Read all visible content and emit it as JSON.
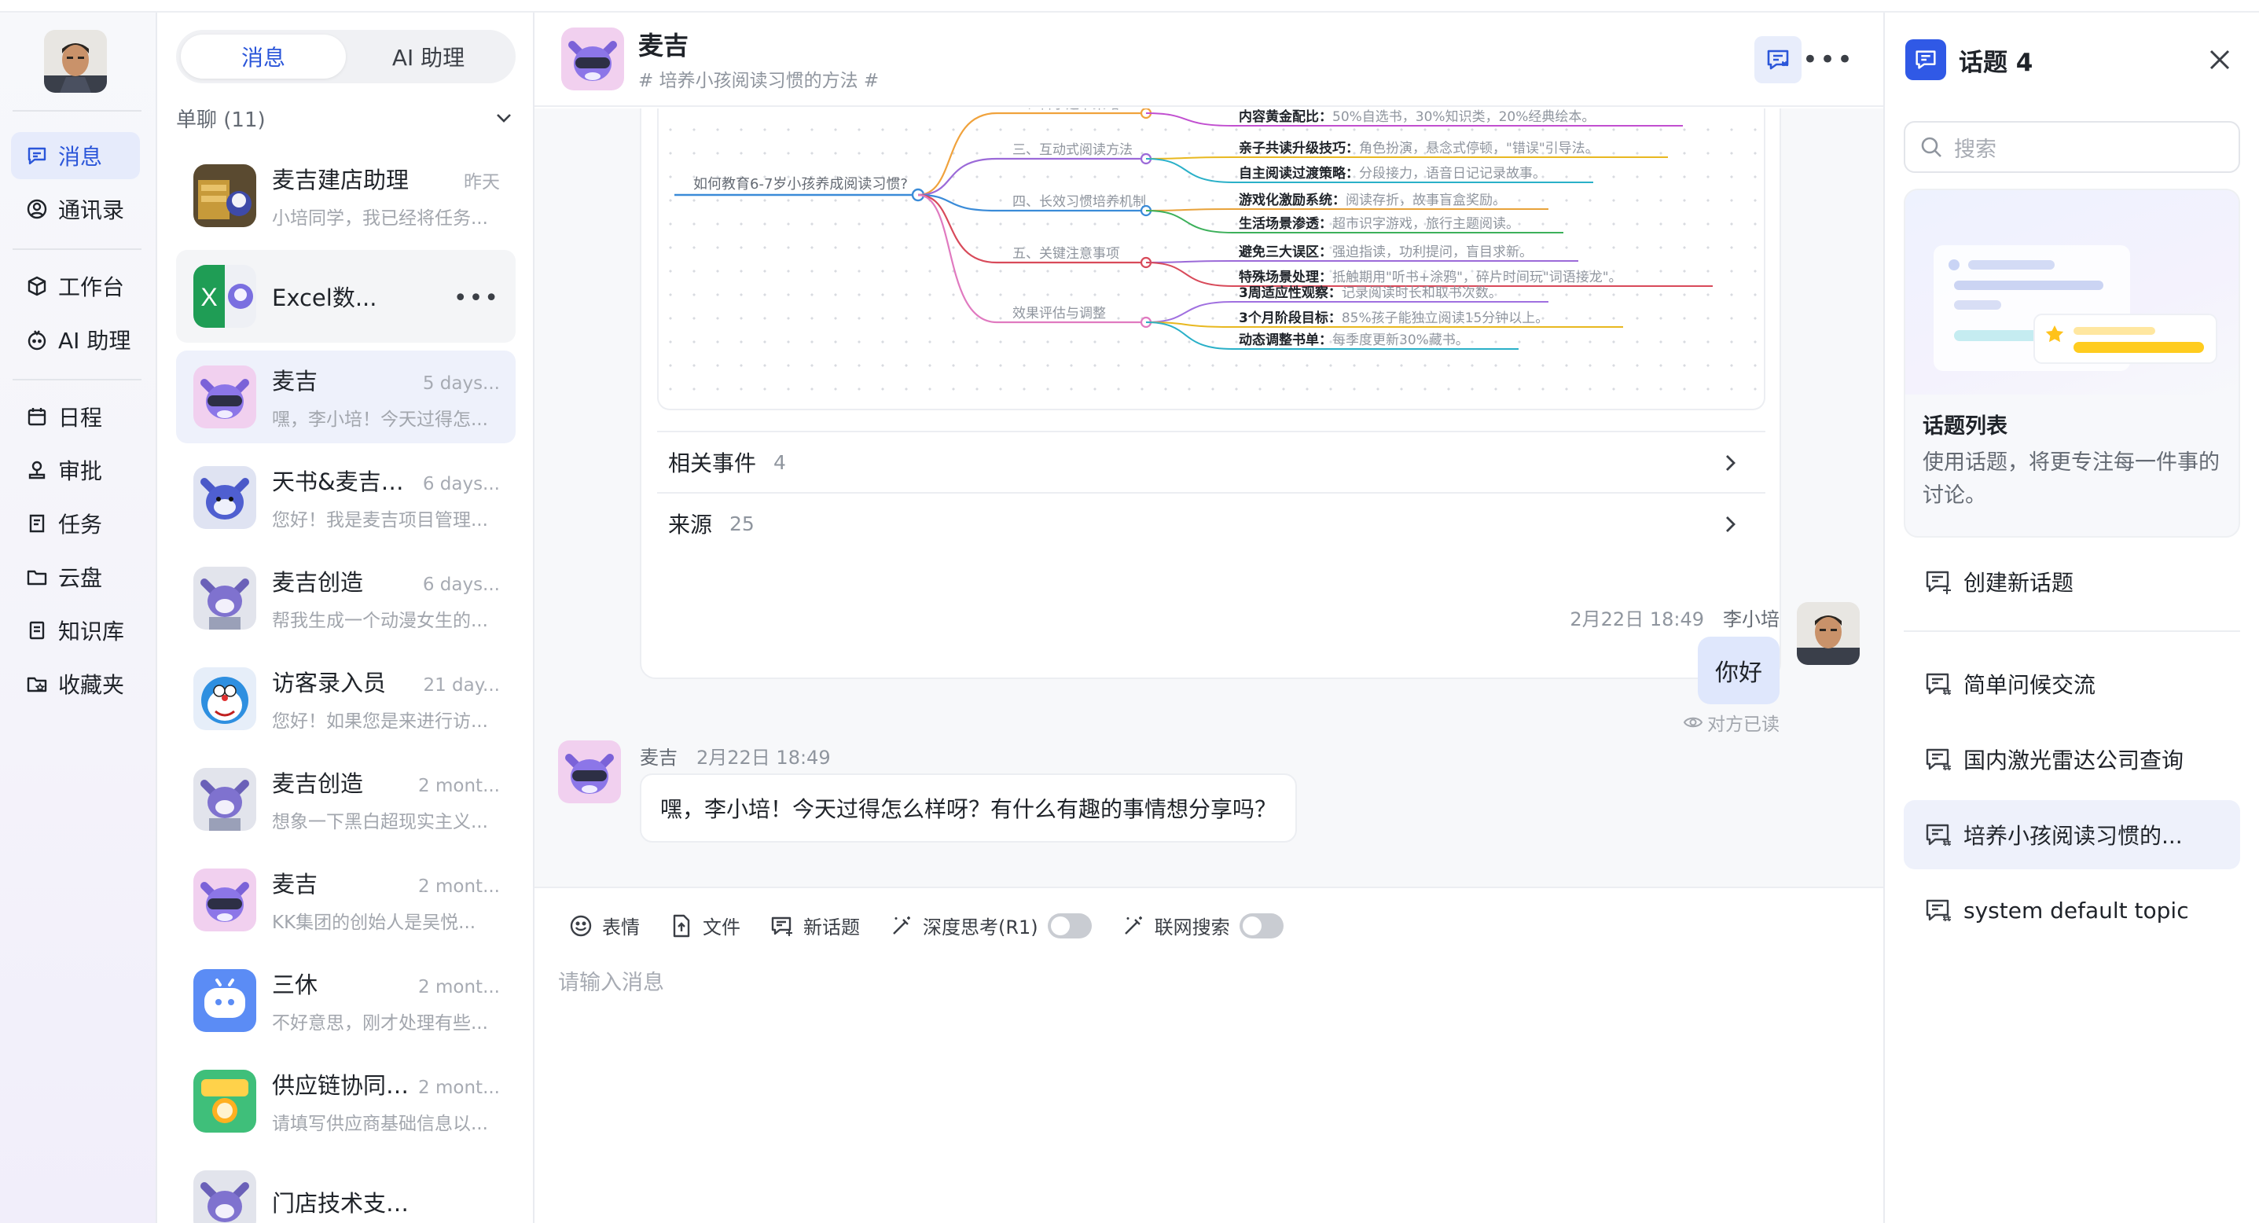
{
  "nav": {
    "items": [
      {
        "label": "消息",
        "icon": "message-icon"
      },
      {
        "label": "通讯录",
        "icon": "contacts-icon"
      },
      {
        "label": "工作台",
        "icon": "workbench-icon"
      },
      {
        "label": "AI 助理",
        "icon": "ai-assistant-icon"
      },
      {
        "label": "日程",
        "icon": "calendar-icon"
      },
      {
        "label": "审批",
        "icon": "approval-icon"
      },
      {
        "label": "任务",
        "icon": "task-icon"
      },
      {
        "label": "云盘",
        "icon": "folder-icon"
      },
      {
        "label": "知识库",
        "icon": "book-icon"
      },
      {
        "label": "收藏夹",
        "icon": "favorites-icon"
      }
    ]
  },
  "list": {
    "tabs": [
      "消息",
      "AI 助理"
    ],
    "group_label": "单聊 (11)",
    "conversations": [
      {
        "name": "麦吉建店助理",
        "time": "昨天",
        "preview": "小培同学，我已经将任务..."
      },
      {
        "name": "Excel数...",
        "time": "",
        "preview": ""
      },
      {
        "name": "麦吉",
        "time": "5 days...",
        "preview": "嘿，李小培！今天过得怎..."
      },
      {
        "name": "天书&麦吉项...",
        "time": "6 days...",
        "preview": "您好！我是麦吉项目管理..."
      },
      {
        "name": "麦吉创造",
        "time": "6 days...",
        "preview": "帮我生成一个动漫女生的..."
      },
      {
        "name": "访客录入员",
        "time": "21 day...",
        "preview": "您好！如果您是来进行访..."
      },
      {
        "name": "麦吉创造",
        "time": "2 mont...",
        "preview": "想象一下黑白超现实主义..."
      },
      {
        "name": "麦吉",
        "time": "2 mont...",
        "preview": "KK集团的创始人是吴悦..."
      },
      {
        "name": "三休",
        "time": "2 mont...",
        "preview": "不好意思，刚才处理有些..."
      },
      {
        "name": "供应链协同助...",
        "time": "2 mont...",
        "preview": "请填写供应商基础信息以..."
      },
      {
        "name": "门店技术支持...",
        "time": "",
        "preview": ""
      }
    ]
  },
  "chat": {
    "title": "麦吉",
    "topic": "# 培养小孩阅读习惯的方法 #",
    "mindmap": {
      "root": "如何教育6-7岁小孩养成阅读习惯?",
      "branches": [
        {
          "label": "二、科学选书策略",
          "leaves": [
            {
              "k": "内容黄金配比",
              "v": "50%自选书，30%知识类，20%经典绘本。"
            }
          ]
        },
        {
          "label": "三、互动式阅读方法",
          "leaves": [
            {
              "k": "亲子共读升级技巧",
              "v": "角色扮演，悬念式停顿，\"错误\"引导法。"
            },
            {
              "k": "自主阅读过渡策略",
              "v": "分段接力，语音日记记录故事。"
            }
          ]
        },
        {
          "label": "四、长效习惯培养机制",
          "leaves": [
            {
              "k": "游戏化激励系统",
              "v": "阅读存折，故事盲盒奖励。"
            },
            {
              "k": "生活场景渗透",
              "v": "超市识字游戏，旅行主题阅读。"
            }
          ]
        },
        {
          "label": "五、关键注意事项",
          "leaves": [
            {
              "k": "避免三大误区",
              "v": "强迫指读，功利提问，盲目求新。"
            },
            {
              "k": "特殊场景处理",
              "v": "抵触期用\"听书+涂鸦\"，碎片时间玩\"词语接龙\"。"
            }
          ]
        },
        {
          "label": "效果评估与调整",
          "leaves": [
            {
              "k": "3周适应性观察",
              "v": "记录阅读时长和取书次数。"
            },
            {
              "k": "3个月阶段目标",
              "v": "85%孩子能独立阅读15分钟以上。"
            },
            {
              "k": "动态调整书单",
              "v": "每季度更新30%藏书。"
            }
          ]
        }
      ]
    },
    "related_label": "相关事件",
    "related_count": "4",
    "source_label": "来源",
    "source_count": "25",
    "user_msg_time": "2月22日 18:49",
    "user_name": "李小培",
    "user_msg": "你好",
    "read_status": "对方已读",
    "bot_name": "麦吉",
    "bot_time": "2月22日 18:49",
    "bot_msg": "嘿，李小培！今天过得怎么样呀？有什么有趣的事情想分享吗？",
    "tools": {
      "emoji": "表情",
      "file": "文件",
      "new_topic": "新话题",
      "deep_think": "深度思考(R1)",
      "web_search": "联网搜索"
    },
    "input_placeholder": "请输入消息"
  },
  "topics": {
    "title": "话题 4",
    "search_placeholder": "搜索",
    "promo_title": "话题列表",
    "promo_desc": "使用话题，将更专注每一件事的讨论。",
    "create_label": "创建新话题",
    "items": [
      "简单问候交流",
      "国内激光雷达公司查询",
      "培养小孩阅读习惯的...",
      "system default topic"
    ]
  },
  "colors": {
    "accent": "#2b56d9",
    "accent_bg": "#e6ebfb",
    "bubble_user": "#dfe7fc"
  }
}
